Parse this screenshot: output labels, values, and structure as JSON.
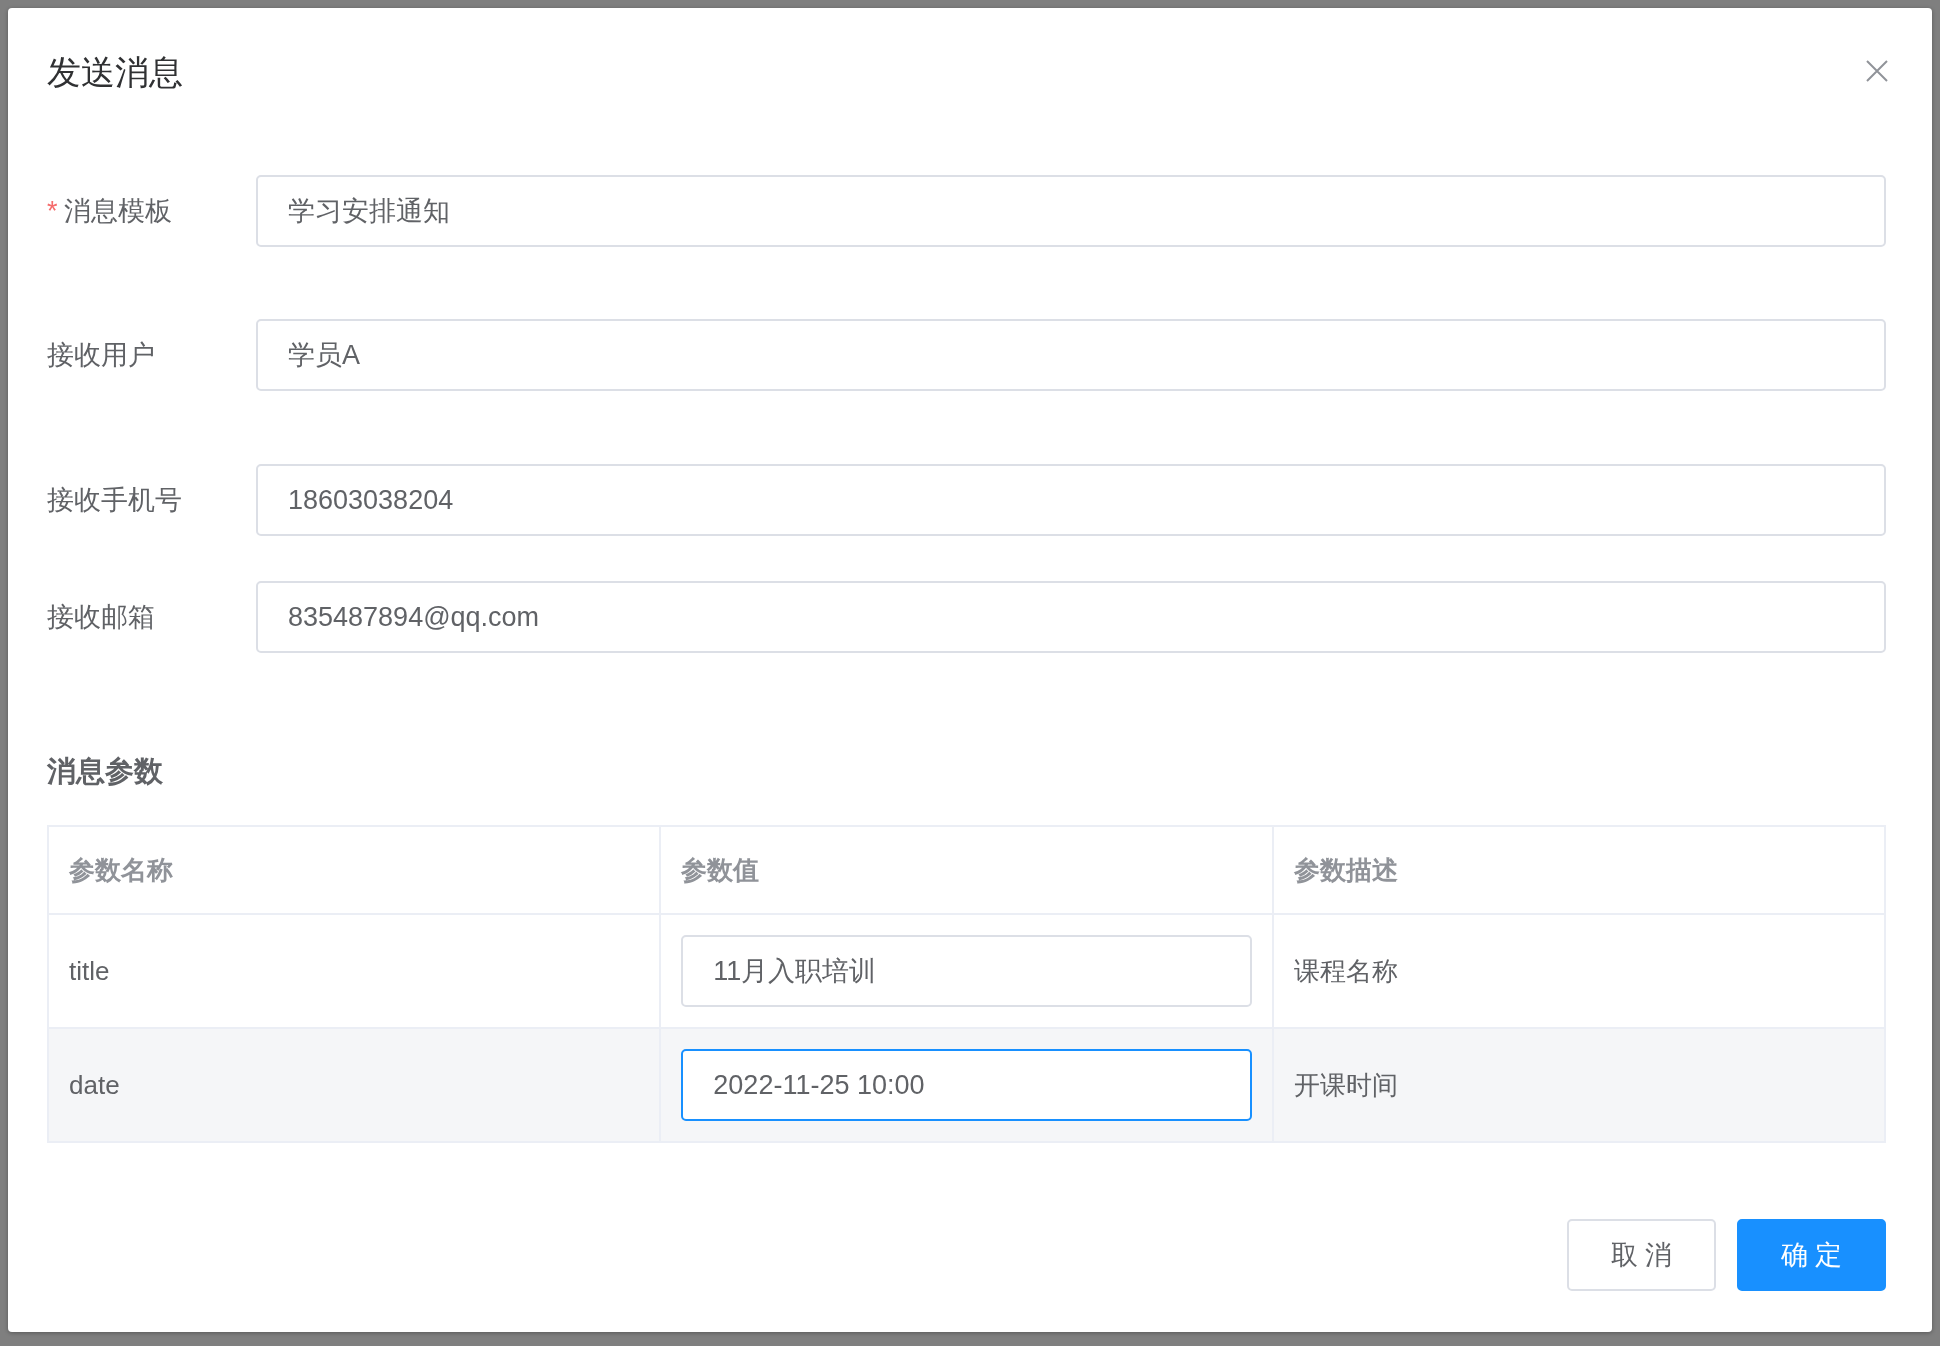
{
  "dialog": {
    "title": "发送消息"
  },
  "fields": [
    {
      "label": "消息模板",
      "required_mark": "*",
      "value": "学习安排通知"
    },
    {
      "label": "接收用户",
      "value": "学员A"
    },
    {
      "label": "接收手机号",
      "value": "18603038204"
    },
    {
      "label": "接收邮箱",
      "value": "835487894@qq.com"
    }
  ],
  "section_title": "消息参数",
  "table": {
    "columns": [
      "参数名称",
      "参数值",
      "参数描述"
    ],
    "rows": [
      {
        "name": "title",
        "value": "11月入职培训",
        "description": "课程名称",
        "focused": false
      },
      {
        "name": "date",
        "value": "2022-11-25 10:00",
        "description": "开课时间",
        "focused": true
      }
    ]
  },
  "buttons": [
    {
      "label": "取 消",
      "kind": "default"
    },
    {
      "label": "确 定",
      "kind": "primary"
    }
  ]
}
